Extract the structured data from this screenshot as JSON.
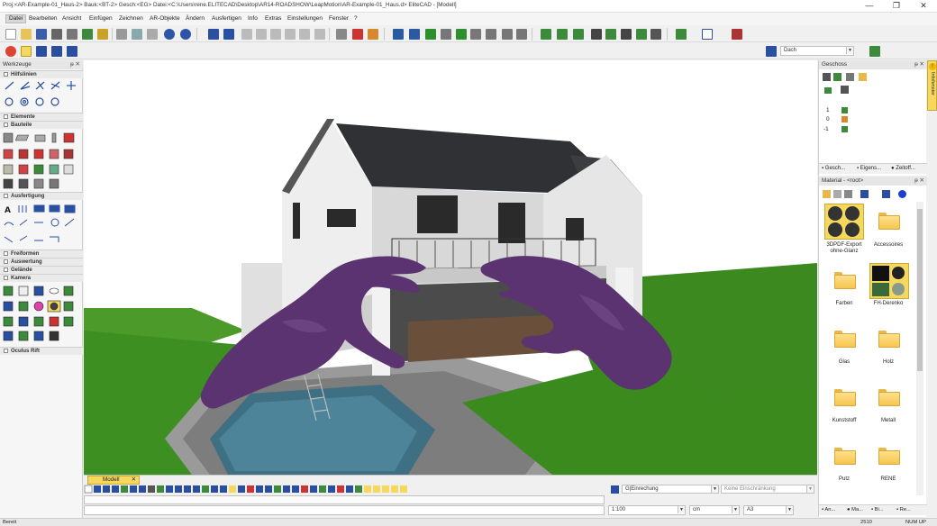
{
  "window": {
    "title": "Proj:<AR-Example-01_Haus-2> Bauk:<BT-2> Gesch:<EG> Datei:<C:\\Users\\rene.ELITECAD\\Desktop\\AR14-ROADSHOW\\LeapMotion\\AR-Example-01_Haus.d> EliteCAD - [Modell]",
    "minimize": "—",
    "restore": "❐",
    "close": "✕"
  },
  "menu": [
    "Datei",
    "Bearbeiten",
    "Ansicht",
    "Einfügen",
    "Zeichnen",
    "AR-Objekte",
    "Ändern",
    "Ausfertigen",
    "Info",
    "Extras",
    "Einstellungen",
    "Fenster",
    "?"
  ],
  "layer_field": {
    "value": "Dach"
  },
  "left_panel": {
    "title": "Werkzeuge",
    "pin": "ᵽ ✕",
    "groups": [
      "Hilfslinien",
      "Elemente",
      "Bauteile",
      "Ausfertigung",
      "Freiformen",
      "Auswertung",
      "Gelände",
      "Kamera",
      "Oculus Rift"
    ]
  },
  "geschoss_panel": {
    "title": "Geschoss",
    "pin": "ᵽ ✕",
    "levels": [
      "1",
      "0",
      "-1"
    ],
    "tabs": [
      "Gesch...",
      "Eigens...",
      "Zeitoff..."
    ]
  },
  "material_panel": {
    "title": "Material - <root>",
    "pin": "ᵽ ✕",
    "items": [
      {
        "label": "3DPDF-Export ohne-Glanz"
      },
      {
        "label": "Accessoires"
      },
      {
        "label": "Farben"
      },
      {
        "label": "FH-Derenko"
      },
      {
        "label": "Glas"
      },
      {
        "label": "Holz"
      },
      {
        "label": "Kunststoff"
      },
      {
        "label": "Metall"
      },
      {
        "label": "Putz"
      },
      {
        "label": "RENE"
      }
    ],
    "tabs": [
      "An...",
      "Ma...",
      "Bi...",
      "Re..."
    ]
  },
  "side_tab": {
    "label": "Infofenster"
  },
  "view_tab": {
    "label": "Modell",
    "close": "✕"
  },
  "bottom": {
    "constraint": "G|Einrechung",
    "restriction": "Keine Einschränkung",
    "scale": "1:100",
    "unit": "cm",
    "paper": "A3"
  },
  "status": {
    "left": "Bereit",
    "coord": "2510",
    "mode": "NUM UP"
  },
  "colors": {
    "sky": "#ffffff",
    "grass": "#3c8a1f",
    "hands": "#5b3370",
    "roof": "#2f3135",
    "wall": "#e8e8e8",
    "pool": "#3f6f82"
  }
}
